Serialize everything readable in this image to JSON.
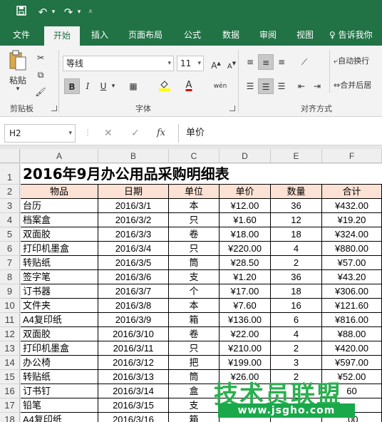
{
  "app": {
    "accent": "#217346",
    "header_fill": "#fbe2d5"
  },
  "qat": {
    "save_icon": "save-icon",
    "undo_icon": "undo-icon",
    "redo_icon": "redo-icon",
    "customize_icon": "customize-qat-icon"
  },
  "ribbon_tabs": [
    "文件",
    "开始",
    "插入",
    "页面布局",
    "公式",
    "数据",
    "审阅",
    "视图"
  ],
  "active_tab": "开始",
  "tell_me": "告诉我你",
  "clipboard": {
    "paste_label": "粘贴",
    "group_label": "剪贴板"
  },
  "font": {
    "font_name": "等线",
    "font_size": "11",
    "group_label": "字体",
    "bold": "B",
    "italic": "I",
    "underline": "U",
    "grow": "A",
    "shrink": "A",
    "font_color_letter": "A",
    "phonetic": "wén"
  },
  "alignment": {
    "wrap_text": "自动换行",
    "merge_center": "合并后居",
    "group_label": "对齐方式"
  },
  "formula_bar": {
    "name_box": "H2",
    "fx": "fx",
    "formula": "单价"
  },
  "columns": [
    "A",
    "B",
    "C",
    "D",
    "E",
    "F"
  ],
  "row_numbers": [
    "1",
    "2",
    "3",
    "4",
    "5",
    "6",
    "7",
    "8",
    "9",
    "10",
    "11",
    "12",
    "13",
    "14",
    "15",
    "16",
    "17",
    "18"
  ],
  "sheet": {
    "title": "2016年9月办公用品采购明细表",
    "headers": [
      "物品",
      "日期",
      "单位",
      "单价",
      "数量",
      "合计"
    ],
    "rows": [
      [
        "台历",
        "2016/3/1",
        "本",
        "¥12.00",
        "36",
        "¥432.00"
      ],
      [
        "档案盒",
        "2016/3/2",
        "只",
        "¥1.60",
        "12",
        "¥19.20"
      ],
      [
        "双面胶",
        "2016/3/3",
        "卷",
        "¥18.00",
        "18",
        "¥324.00"
      ],
      [
        "打印机墨盒",
        "2016/3/4",
        "只",
        "¥220.00",
        "4",
        "¥880.00"
      ],
      [
        "转贴纸",
        "2016/3/5",
        "筒",
        "¥28.50",
        "2",
        "¥57.00"
      ],
      [
        "签字笔",
        "2016/3/6",
        "支",
        "¥1.20",
        "36",
        "¥43.20"
      ],
      [
        "订书器",
        "2016/3/7",
        "个",
        "¥17.00",
        "18",
        "¥306.00"
      ],
      [
        "文件夹",
        "2016/3/8",
        "本",
        "¥7.60",
        "16",
        "¥121.60"
      ],
      [
        "A4复印纸",
        "2016/3/9",
        "箱",
        "¥136.00",
        "6",
        "¥816.00"
      ],
      [
        "双面胶",
        "2016/3/10",
        "卷",
        "¥22.00",
        "4",
        "¥88.00"
      ],
      [
        "打印机墨盒",
        "2016/3/11",
        "只",
        "¥210.00",
        "2",
        "¥420.00"
      ],
      [
        "办公椅",
        "2016/3/12",
        "把",
        "¥199.00",
        "3",
        "¥597.00"
      ],
      [
        "转贴纸",
        "2016/3/13",
        "筒",
        "¥26.00",
        "2",
        "¥52.00"
      ],
      [
        "订书钉",
        "2016/3/14",
        "盒",
        "",
        "",
        "60"
      ],
      [
        "铅笔",
        "2016/3/15",
        "支",
        "",
        "",
        ""
      ],
      [
        "A4复印纸",
        "2016/3/16",
        "箱",
        "",
        "",
        ".00"
      ]
    ]
  },
  "watermark": {
    "line1": "技术员联盟",
    "line2": "www.jsgho.com"
  }
}
